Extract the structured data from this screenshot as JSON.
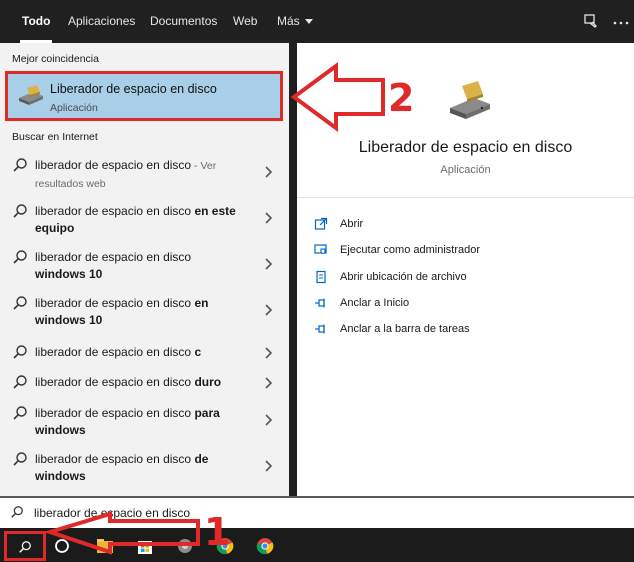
{
  "tabs": [
    {
      "label": "Todo"
    },
    {
      "label": "Aplicaciones"
    },
    {
      "label": "Documentos"
    },
    {
      "label": "Web"
    },
    {
      "label": "Más"
    }
  ],
  "left": {
    "best_match_heading": "Mejor coincidencia",
    "best_match": {
      "title": "Liberador de espacio en disco",
      "subtitle": "Aplicación",
      "icon": "disk-cleanup-icon"
    },
    "web_heading": "Buscar en Internet",
    "web_results": [
      {
        "main": "liberador de espacio en disco",
        "bold": "",
        "suffix": " - Ver",
        "suffix2": "resultados web"
      },
      {
        "main": "liberador de espacio en disco ",
        "bold": "en este",
        "line2": "equipo"
      },
      {
        "main": "liberador de espacio en disco",
        "bold": "",
        "line2": "windows 10"
      },
      {
        "main": "liberador de espacio en disco ",
        "bold": "en",
        "line2": "windows 10"
      },
      {
        "main": "liberador de espacio en disco ",
        "bold": "c"
      },
      {
        "main": "liberador de espacio en disco ",
        "bold": "duro"
      },
      {
        "main": "liberador de espacio en disco ",
        "bold": "para",
        "line2": "windows"
      },
      {
        "main": "liberador de espacio en disco ",
        "bold": "de",
        "line2": "windows"
      }
    ]
  },
  "right": {
    "title": "Liberador de espacio en disco",
    "subtitle": "Aplicación",
    "actions": [
      {
        "label": "Abrir",
        "icon": "open-icon"
      },
      {
        "label": "Ejecutar como administrador",
        "icon": "run-as-admin-icon"
      },
      {
        "label": "Abrir ubicación de archivo",
        "icon": "file-location-icon"
      },
      {
        "label": "Anclar a Inicio",
        "icon": "pin-icon"
      },
      {
        "label": "Anclar a la barra de tareas",
        "icon": "pin-icon"
      }
    ]
  },
  "search": {
    "value": "liberador de espacio en disco"
  },
  "annotations": {
    "step1": "1",
    "step2": "2",
    "color": "#e02a2a"
  },
  "colors": {
    "selected_bg": "#a9cfe8",
    "taskbar": "#1b1b1b",
    "topbar": "#202020"
  }
}
